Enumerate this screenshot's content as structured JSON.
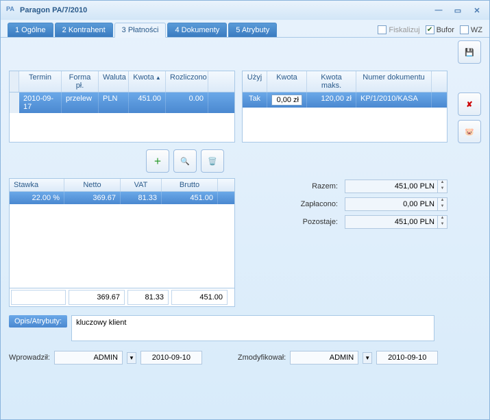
{
  "window": {
    "title": "Paragon PA/7/2010"
  },
  "tabs": [
    {
      "label": "1 Ogólne"
    },
    {
      "label": "2 Kontrahent"
    },
    {
      "label": "3 Płatności"
    },
    {
      "label": "4 Dokumenty"
    },
    {
      "label": "5 Atrybuty"
    }
  ],
  "checks": {
    "fisk": "Fiskalizuj",
    "bufor": "Bufor",
    "wz": "WZ"
  },
  "grid_left": {
    "headers": {
      "termin": "Termin",
      "forma": "Forma pł.",
      "waluta": "Waluta",
      "kwota": "Kwota",
      "rozl": "Rozliczono"
    },
    "row": {
      "termin": "2010-09-17",
      "forma": "przelew",
      "waluta": "PLN",
      "kwota": "451.00",
      "rozl": "0.00"
    }
  },
  "grid_right": {
    "headers": {
      "uzyj": "Użyj",
      "kwota": "Kwota",
      "kwmax": "Kwota maks.",
      "doc": "Numer dokumentu"
    },
    "row": {
      "uzyj": "Tak",
      "kwota": "0,00 zł",
      "kwmax": "120,00 zł",
      "doc": "KP/1/2010/KASA"
    }
  },
  "vat": {
    "headers": {
      "stawka": "Stawka",
      "netto": "Netto",
      "vat": "VAT",
      "brutto": "Brutto"
    },
    "row": {
      "stawka": "22.00 %",
      "netto": "369.67",
      "vat": "81.33",
      "brutto": "451.00"
    },
    "footer": {
      "netto": "369.67",
      "vat": "81.33",
      "brutto": "451.00"
    }
  },
  "totals": {
    "razem_l": "Razem:",
    "razem_v": "451,00 PLN",
    "zap_l": "Zapłacono:",
    "zap_v": "0,00 PLN",
    "poz_l": "Pozostaje:",
    "poz_v": "451,00 PLN"
  },
  "opis": {
    "label": "Opis/Atrybuty:",
    "text": "kluczowy klient"
  },
  "footer": {
    "wpr_l": "Wprowadził:",
    "wpr_u": "ADMIN",
    "wpr_d": "2010-09-10",
    "zmod_l": "Zmodyfikował:",
    "zmod_u": "ADMIN",
    "zmod_d": "2010-09-10"
  }
}
